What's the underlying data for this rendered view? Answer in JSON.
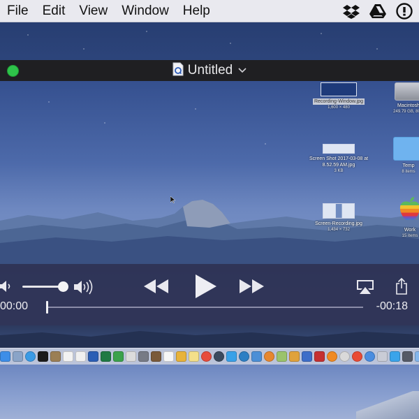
{
  "menubar": {
    "items": [
      "File",
      "Edit",
      "View",
      "Window",
      "Help"
    ],
    "status_icons": [
      "dropbox-icon",
      "google-drive-icon",
      "info-circle-icon"
    ]
  },
  "window": {
    "title": "Untitled",
    "doc_icon": "quicktime-document-icon",
    "title_menu_icon": "chevron-down-icon"
  },
  "desktop_icons": [
    {
      "label": "Recording-Window.jpg",
      "sub": "1,600 × 480",
      "selected": true
    },
    {
      "label": "Macintosh",
      "sub": "249.79 GB, 80.3"
    },
    {
      "label": "Screen Shot 2017-03-08 at 8.52.59 AM.jpg",
      "sub": "3 KB"
    },
    {
      "label": "Temp",
      "sub": "8 items"
    },
    {
      "label": "Screen-Recording.jpg",
      "sub": "1,434 × 732"
    },
    {
      "label": "Work",
      "sub": "15 items"
    }
  ],
  "player": {
    "time_elapsed": "00:00",
    "time_remaining": "-00:18",
    "progress": 0.0,
    "volume": 0.9,
    "icons": [
      "volume-low-icon",
      "volume-high-icon",
      "rewind-icon",
      "play-icon",
      "fast-forward-icon",
      "airplay-icon",
      "share-icon"
    ]
  },
  "dock": {
    "apps": [
      {
        "name": "finder-icon",
        "color": "#3d8ee8"
      },
      {
        "name": "launchpad-icon",
        "color": "#8aa4c8"
      },
      {
        "name": "safari-icon",
        "color": "#3a9be6"
      },
      {
        "name": "terminal-icon",
        "color": "#1b1b1b"
      },
      {
        "name": "preview-icon",
        "color": "#9b7f55"
      },
      {
        "name": "calendar-icon",
        "color": "#f2f2f2"
      },
      {
        "name": "textedit-icon",
        "color": "#f0f0f0"
      },
      {
        "name": "word-icon",
        "color": "#2b5eb5"
      },
      {
        "name": "excel-icon",
        "color": "#1f7a44"
      },
      {
        "name": "numbers-icon",
        "color": "#3ba24b"
      },
      {
        "name": "script-editor-icon",
        "color": "#dcdcdc"
      },
      {
        "name": "system-preferences-icon",
        "color": "#777b86"
      },
      {
        "name": "dictionary-icon",
        "color": "#7a5a3a"
      },
      {
        "name": "pages-icon",
        "color": "#f6f6f6"
      },
      {
        "name": "photos-icon",
        "color": "#e8b33a"
      },
      {
        "name": "notes-icon",
        "color": "#f4e08a"
      },
      {
        "name": "chrome-icon",
        "color": "#e74c3c"
      },
      {
        "name": "steam-icon",
        "color": "#3b4a5e"
      },
      {
        "name": "twitter-icon",
        "color": "#39a1e8"
      },
      {
        "name": "globe-icon",
        "color": "#2d7fc4"
      },
      {
        "name": "image-capture-icon",
        "color": "#4c8fd6"
      },
      {
        "name": "firefox-icon",
        "color": "#e7872e"
      },
      {
        "name": "maps-icon",
        "color": "#9bc36b"
      },
      {
        "name": "stocks-icon",
        "color": "#e0a23c"
      },
      {
        "name": "xcode-icon",
        "color": "#3d6ec9"
      },
      {
        "name": "scrivener-icon",
        "color": "#c53030"
      },
      {
        "name": "firefox-alt-icon",
        "color": "#f08a24"
      },
      {
        "name": "info-icon",
        "color": "#d9d9d9"
      },
      {
        "name": "chrome-alt-icon",
        "color": "#e94b35"
      },
      {
        "name": "itunes-icon",
        "color": "#4a8de0"
      },
      {
        "name": "disk-utility-icon",
        "color": "#c9ccd6"
      },
      {
        "name": "messages-icon",
        "color": "#3aa4ea"
      },
      {
        "name": "network-icon",
        "color": "#555a66"
      },
      {
        "name": "mail-icon",
        "color": "#84b6ec"
      },
      {
        "name": "folder-icon",
        "color": "#6aa9e6"
      },
      {
        "name": "quicktime-icon",
        "color": "#1e2a4a"
      },
      {
        "name": "downloads-icon",
        "color": "#b7bfd3"
      },
      {
        "name": "trash-icon",
        "color": "#aeb4c2"
      }
    ]
  }
}
